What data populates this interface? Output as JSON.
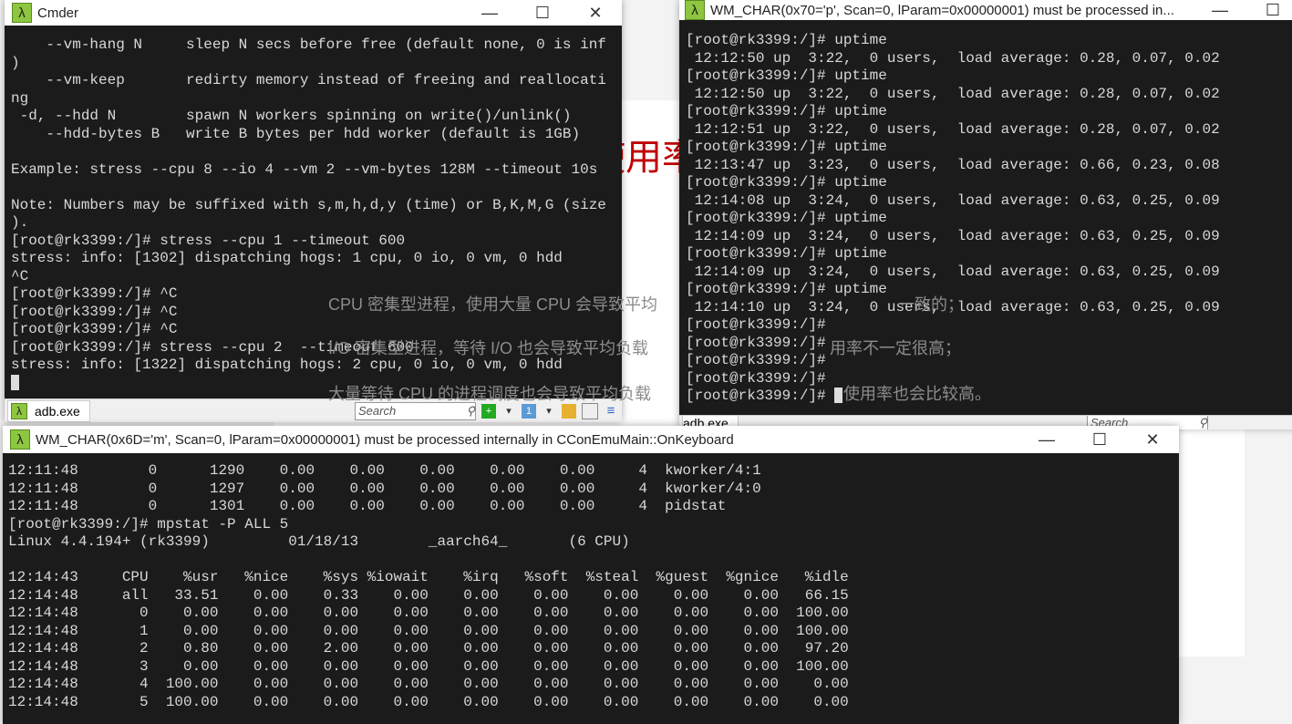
{
  "background": {
    "slide_title": "平均负载与 CPU 使用率",
    "bullets": [
      "CPU 密集型进程，使用大量 CPU 会导致平均",
      "I/O 密集型进程，等待 I/O 也会导致平均负载",
      "大量等待 CPU 的进程调度也会导致平均负载"
    ],
    "bullet_tails": [
      "一致的；",
      "用率不一定很高；",
      "使用率也会比较高。"
    ]
  },
  "cmder": {
    "title": "Cmder",
    "lines": [
      "    --vm-hang N     sleep N secs before free (default none, 0 is inf",
      ")",
      "    --vm-keep       redirty memory instead of freeing and reallocati",
      "ng",
      " -d, --hdd N        spawn N workers spinning on write()/unlink()",
      "    --hdd-bytes B   write B bytes per hdd worker (default is 1GB)",
      "",
      "Example: stress --cpu 8 --io 4 --vm 2 --vm-bytes 128M --timeout 10s",
      "",
      "Note: Numbers may be suffixed with s,m,h,d,y (time) or B,K,M,G (size",
      ").",
      "[root@rk3399:/]# stress --cpu 1 --timeout 600",
      "stress: info: [1302] dispatching hogs: 1 cpu, 0 io, 0 vm, 0 hdd",
      "^C",
      "[root@rk3399:/]# ^C",
      "[root@rk3399:/]# ^C",
      "[root@rk3399:/]# ^C",
      "[root@rk3399:/]# stress --cpu 2  --timeout 600",
      "stress: info: [1322] dispatching hogs: 2 cpu, 0 io, 0 vm, 0 hdd"
    ],
    "tab_label": "adb.exe",
    "search_placeholder": "Search"
  },
  "uptime_window": {
    "title": "WM_CHAR(0x70='p', Scan=0, lParam=0x00000001) must be processed in...",
    "lines": [
      "[root@rk3399:/]# uptime",
      " 12:12:50 up  3:22,  0 users,  load average: 0.28, 0.07, 0.02",
      "[root@rk3399:/]# uptime",
      " 12:12:50 up  3:22,  0 users,  load average: 0.28, 0.07, 0.02",
      "[root@rk3399:/]# uptime",
      " 12:12:51 up  3:22,  0 users,  load average: 0.28, 0.07, 0.02",
      "[root@rk3399:/]# uptime",
      " 12:13:47 up  3:23,  0 users,  load average: 0.66, 0.23, 0.08",
      "[root@rk3399:/]# uptime",
      " 12:14:08 up  3:24,  0 users,  load average: 0.63, 0.25, 0.09",
      "[root@rk3399:/]# uptime",
      " 12:14:09 up  3:24,  0 users,  load average: 0.63, 0.25, 0.09",
      "[root@rk3399:/]# uptime",
      " 12:14:09 up  3:24,  0 users,  load average: 0.63, 0.25, 0.09",
      "[root@rk3399:/]# uptime",
      " 12:14:10 up  3:24,  0 users,  load average: 0.63, 0.25, 0.09",
      "[root@rk3399:/]#",
      "[root@rk3399:/]#",
      "[root@rk3399:/]#",
      "[root@rk3399:/]#",
      "[root@rk3399:/]# "
    ],
    "tab_label": "adb.exe",
    "search_placeholder": "Search"
  },
  "mpstat_window": {
    "title": "WM_CHAR(0x6D='m', Scan=0, lParam=0x00000001) must be processed internally in CConEmuMain::OnKeyboard",
    "lines": [
      "12:11:48        0      1290    0.00    0.00    0.00    0.00    0.00     4  kworker/4:1",
      "12:11:48        0      1297    0.00    0.00    0.00    0.00    0.00     4  kworker/4:0",
      "12:11:48        0      1301    0.00    0.00    0.00    0.00    0.00     4  pidstat",
      "[root@rk3399:/]# mpstat -P ALL 5",
      "Linux 4.4.194+ (rk3399)         01/18/13        _aarch64_       (6 CPU)",
      "",
      "12:14:43     CPU    %usr   %nice    %sys %iowait    %irq   %soft  %steal  %guest  %gnice   %idle",
      "12:14:48     all   33.51    0.00    0.33    0.00    0.00    0.00    0.00    0.00    0.00   66.15",
      "12:14:48       0    0.00    0.00    0.00    0.00    0.00    0.00    0.00    0.00    0.00  100.00",
      "12:14:48       1    0.00    0.00    0.00    0.00    0.00    0.00    0.00    0.00    0.00  100.00",
      "12:14:48       2    0.80    0.00    2.00    0.00    0.00    0.00    0.00    0.00    0.00   97.20",
      "12:14:48       3    0.00    0.00    0.00    0.00    0.00    0.00    0.00    0.00    0.00  100.00",
      "12:14:48       4  100.00    0.00    0.00    0.00    0.00    0.00    0.00    0.00    0.00    0.00",
      "12:14:48       5  100.00    0.00    0.00    0.00    0.00    0.00    0.00    0.00    0.00    0.00"
    ]
  },
  "window_controls": {
    "minimize": "—",
    "maximize": "☐",
    "close": "✕"
  },
  "icons": {
    "app": "λ"
  }
}
